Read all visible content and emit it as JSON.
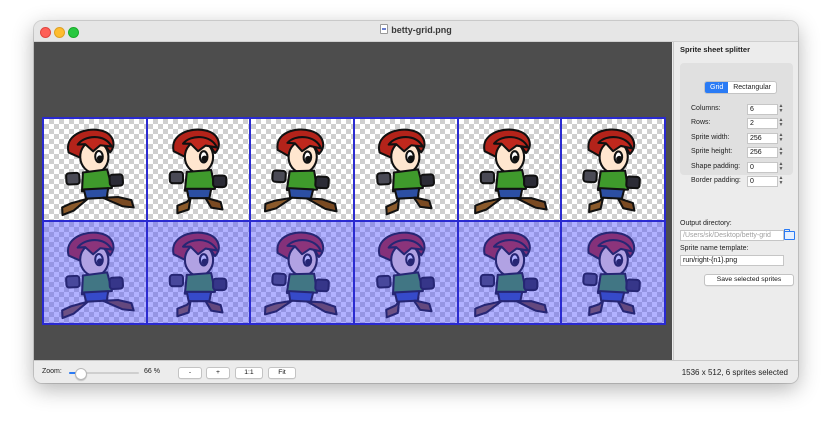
{
  "window": {
    "title": "betty-grid.png"
  },
  "sheet": {
    "columns": 6,
    "rows": 2,
    "selected_row": 2
  },
  "sidebar": {
    "title": "Sprite sheet splitter",
    "modes": [
      {
        "label": "Grid",
        "active": true
      },
      {
        "label": "Rectangular",
        "active": false
      }
    ],
    "fields": [
      {
        "label": "Columns:",
        "value": "6"
      },
      {
        "label": "Rows:",
        "value": "2"
      },
      {
        "label": "Sprite width:",
        "value": "256"
      },
      {
        "label": "Sprite height:",
        "value": "256"
      },
      {
        "label": "Shape padding:",
        "value": "0"
      },
      {
        "label": "Border padding:",
        "value": "0"
      }
    ],
    "output_directory": {
      "label": "Output directory:",
      "value": "/Users/sk/Desktop/betty-grid"
    },
    "name_template": {
      "label": "Sprite name template:",
      "value": "run/right-{n1}.png"
    },
    "save_label": "Save selected sprites"
  },
  "statusbar": {
    "zoom_label": "Zoom:",
    "zoom_value": "66 %",
    "zoom_fraction": 0.66,
    "buttons": {
      "zoom_out": "-",
      "zoom_in": "+",
      "actual": "1:1",
      "fit": "Fit"
    },
    "status": "1536 x 512, 6 sprites selected"
  },
  "colors": {
    "accent": "#2a7bf5",
    "grid_line": "#2a2ad0",
    "selection_tint": "#4646ff"
  }
}
